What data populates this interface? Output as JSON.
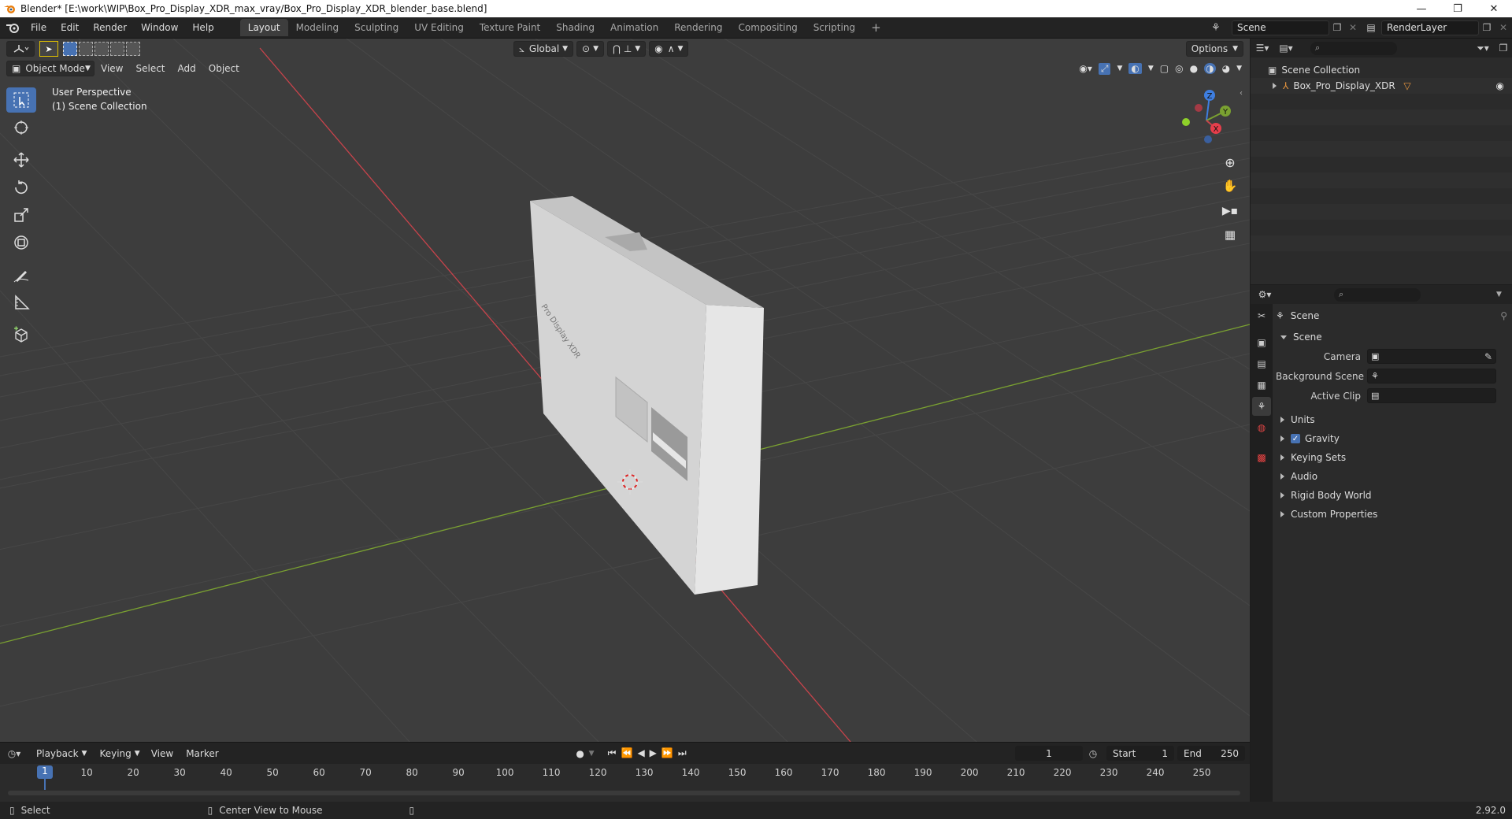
{
  "window": {
    "title": "Blender* [E:\\work\\WIP\\Box_Pro_Display_XDR_max_vray/Box_Pro_Display_XDR_blender_base.blend]",
    "minimize": "—",
    "restore": "❐",
    "close": "✕"
  },
  "menu": {
    "items": [
      "File",
      "Edit",
      "Render",
      "Window",
      "Help"
    ]
  },
  "workspaces": [
    "Layout",
    "Modeling",
    "Sculpting",
    "UV Editing",
    "Texture Paint",
    "Shading",
    "Animation",
    "Rendering",
    "Compositing",
    "Scripting"
  ],
  "workspace_add": "+",
  "scene": {
    "name": "Scene",
    "render_layer": "RenderLayer"
  },
  "viewport": {
    "orientation": "Global",
    "options": "Options",
    "mode": "Object Mode",
    "menus": [
      "View",
      "Select",
      "Add",
      "Object"
    ],
    "perspective": "User Perspective",
    "collection": "(1) Scene Collection",
    "box_label": "Pro Display XDR",
    "gizmo": {
      "z": "Z",
      "y": "Y",
      "x": "X"
    }
  },
  "outliner": {
    "root": "Scene Collection",
    "items": [
      "Box_Pro_Display_XDR"
    ]
  },
  "properties": {
    "context": "Scene",
    "panel": "Scene",
    "fields": [
      {
        "label": "Camera",
        "value": ""
      },
      {
        "label": "Background Scene",
        "value": ""
      },
      {
        "label": "Active Clip",
        "value": ""
      }
    ],
    "subpanels": [
      "Units",
      "Gravity",
      "Keying Sets",
      "Audio",
      "Rigid Body World",
      "Custom Properties"
    ]
  },
  "timeline": {
    "menus": [
      "Playback",
      "Keying",
      "View",
      "Marker"
    ],
    "current_frame": "1",
    "start_label": "Start",
    "start": "1",
    "end_label": "End",
    "end": "250",
    "ticks": [
      "10",
      "20",
      "30",
      "40",
      "50",
      "60",
      "70",
      "80",
      "90",
      "100",
      "110",
      "120",
      "130",
      "140",
      "150",
      "160",
      "170",
      "180",
      "190",
      "200",
      "210",
      "220",
      "230",
      "240",
      "250"
    ]
  },
  "status": {
    "select": "Select",
    "center_view": "Center View to Mouse",
    "version": "2.92.0"
  },
  "colors": {
    "accent": "#4772b3",
    "x_axis": "#c8434b",
    "y_axis": "#7aa131",
    "z_axis": "#3e7ee0",
    "grid": "#484848",
    "box_front": "#d2d2d2",
    "box_side": "#e4e4e4"
  }
}
